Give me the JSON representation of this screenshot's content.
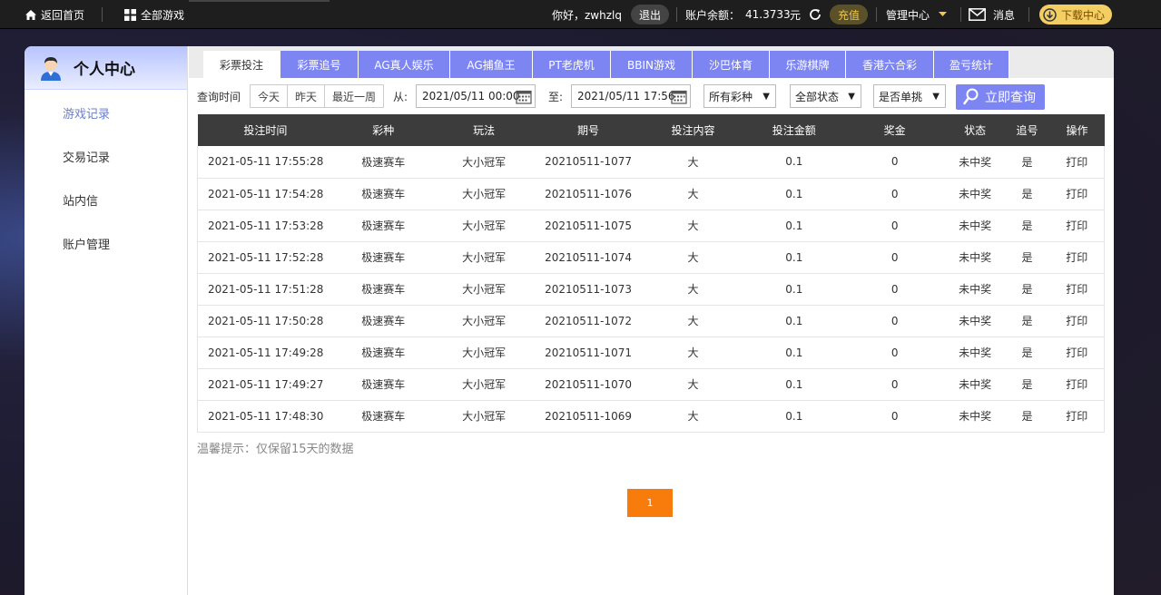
{
  "topbar": {
    "home": "返回首页",
    "all_games": "全部游戏",
    "greeting": "你好，zwhzlq",
    "logout": "退出",
    "balance_label": "账户余额：",
    "balance_value": "41.3733",
    "balance_unit": "元",
    "recharge": "充值",
    "manage": "管理中心",
    "messages": "消息",
    "download": "下载中心"
  },
  "sidebar": {
    "title": "个人中心",
    "items": [
      {
        "label": "游戏记录",
        "active": true
      },
      {
        "label": "交易记录",
        "active": false
      },
      {
        "label": "站内信",
        "active": false
      },
      {
        "label": "账户管理",
        "active": false
      }
    ]
  },
  "tabs": [
    {
      "label": "彩票投注",
      "active": true
    },
    {
      "label": "彩票追号",
      "active": false
    },
    {
      "label": "AG真人娱乐",
      "active": false
    },
    {
      "label": "AG捕鱼王",
      "active": false
    },
    {
      "label": "PT老虎机",
      "active": false
    },
    {
      "label": "BBIN游戏",
      "active": false
    },
    {
      "label": "沙巴体育",
      "active": false
    },
    {
      "label": "乐游棋牌",
      "active": false
    },
    {
      "label": "香港六合彩",
      "active": false
    },
    {
      "label": "盈亏统计",
      "active": false
    }
  ],
  "filter": {
    "query_time_label": "查询时间",
    "quick": [
      "今天",
      "昨天",
      "最近一周"
    ],
    "from_label": "从:",
    "from_value": "2021/05/11 00:00",
    "to_label": "至:",
    "to_value": "2021/05/11 17:56",
    "lottery_select": "所有彩种",
    "status_select": "全部状态",
    "single_select": "是否单挑",
    "query_button": "立即查询"
  },
  "table": {
    "headers": [
      "投注时间",
      "彩种",
      "玩法",
      "期号",
      "投注内容",
      "投注金额",
      "奖金",
      "状态",
      "追号",
      "操作"
    ],
    "rows": [
      [
        "2021-05-11 17:55:28",
        "极速赛车",
        "大小冠军",
        "20210511-1077",
        "大",
        "0.1",
        "0",
        "未中奖",
        "是",
        "打印"
      ],
      [
        "2021-05-11 17:54:28",
        "极速赛车",
        "大小冠军",
        "20210511-1076",
        "大",
        "0.1",
        "0",
        "未中奖",
        "是",
        "打印"
      ],
      [
        "2021-05-11 17:53:28",
        "极速赛车",
        "大小冠军",
        "20210511-1075",
        "大",
        "0.1",
        "0",
        "未中奖",
        "是",
        "打印"
      ],
      [
        "2021-05-11 17:52:28",
        "极速赛车",
        "大小冠军",
        "20210511-1074",
        "大",
        "0.1",
        "0",
        "未中奖",
        "是",
        "打印"
      ],
      [
        "2021-05-11 17:51:28",
        "极速赛车",
        "大小冠军",
        "20210511-1073",
        "大",
        "0.1",
        "0",
        "未中奖",
        "是",
        "打印"
      ],
      [
        "2021-05-11 17:50:28",
        "极速赛车",
        "大小冠军",
        "20210511-1072",
        "大",
        "0.1",
        "0",
        "未中奖",
        "是",
        "打印"
      ],
      [
        "2021-05-11 17:49:28",
        "极速赛车",
        "大小冠军",
        "20210511-1071",
        "大",
        "0.1",
        "0",
        "未中奖",
        "是",
        "打印"
      ],
      [
        "2021-05-11 17:49:27",
        "极速赛车",
        "大小冠军",
        "20210511-1070",
        "大",
        "0.1",
        "0",
        "未中奖",
        "是",
        "打印"
      ],
      [
        "2021-05-11 17:48:30",
        "极速赛车",
        "大小冠军",
        "20210511-1069",
        "大",
        "0.1",
        "0",
        "未中奖",
        "是",
        "打印"
      ]
    ]
  },
  "tip": "温馨提示：仅保留15天的数据",
  "pagination": {
    "current": "1"
  },
  "icons": {
    "home": "home-icon",
    "grid": "grid-icon",
    "refresh": "refresh-icon",
    "caret": "caret-down-icon",
    "mail": "mail-icon",
    "download": "download-icon",
    "avatar": "user-avatar-icon",
    "calendar": "calendar-icon",
    "search": "search-icon"
  },
  "colors": {
    "accent": "#7d85f2",
    "topbar": "#1e1e1e",
    "gold": "#f2c84b",
    "page": "#f77c0b"
  }
}
